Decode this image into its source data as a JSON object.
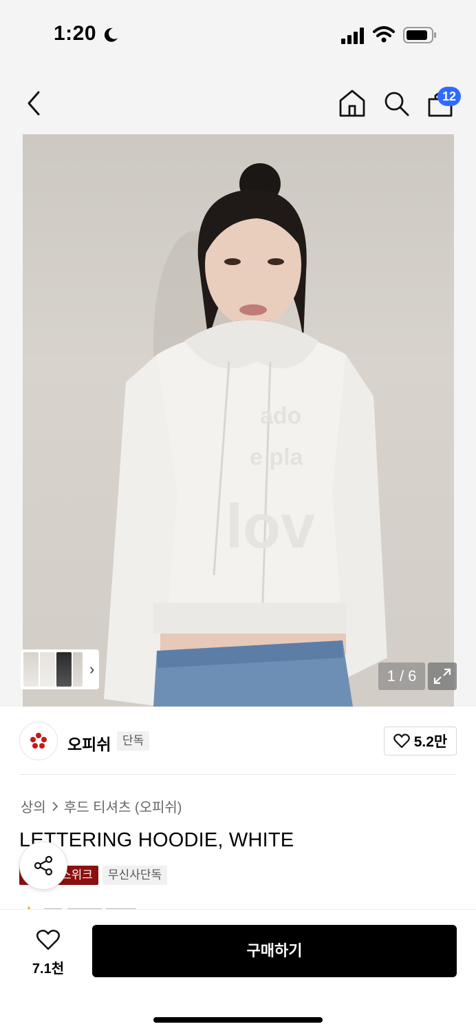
{
  "status_bar": {
    "time": "1:20"
  },
  "nav": {
    "cart_count": "12"
  },
  "gallery": {
    "page_indicator": "1 / 6"
  },
  "brand": {
    "name": "오피쉬",
    "tag": "단독",
    "likes": "5.2만"
  },
  "breadcrumb": {
    "category": "상의",
    "subcategory": "후드 티셔츠 (오피쉬)"
  },
  "product": {
    "title": "LETTERING HOODIE, WHITE",
    "tags": [
      "스위크",
      "무신사단독"
    ]
  },
  "bottom_bar": {
    "wish_count": "7.1천",
    "buy_label": "구매하기"
  },
  "colors": {
    "accent_blue": "#2f6bff",
    "tag_red": "#8b1010",
    "buy_button": "#000000"
  }
}
